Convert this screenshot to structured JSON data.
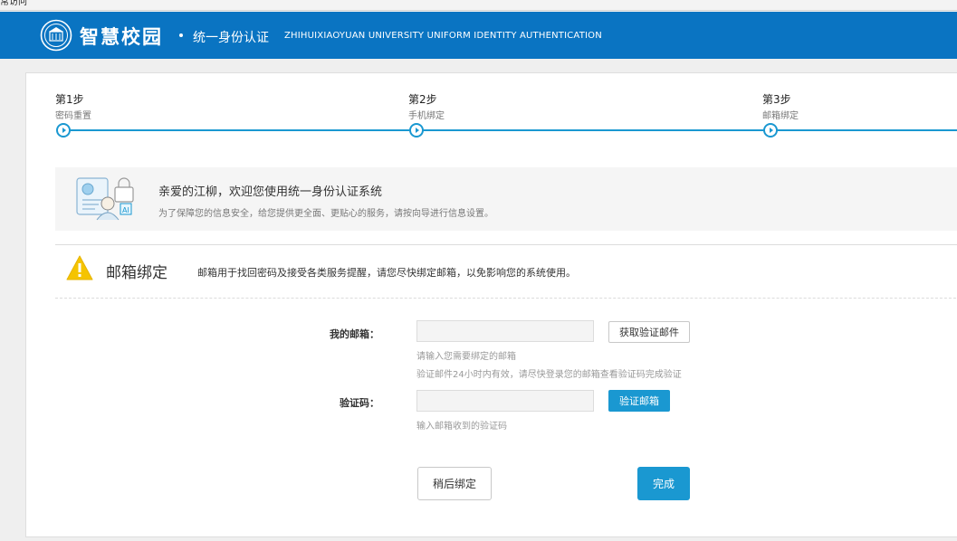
{
  "browser": {
    "top_strip_text": "常访问"
  },
  "header": {
    "logo_text": "智慧校园",
    "subtitle": "统一身份认证",
    "english": "ZHIHUIXIAOYUAN UNIVERSITY UNIFORM IDENTITY AUTHENTICATION"
  },
  "steps": [
    {
      "title": "第1步",
      "desc": "密码重置"
    },
    {
      "title": "第2步",
      "desc": "手机绑定"
    },
    {
      "title": "第3步",
      "desc": "邮箱绑定"
    }
  ],
  "welcome": {
    "title": "亲爱的江柳，欢迎您使用统一身份认证系统",
    "desc": "为了保障您的信息安全，给您提供更全面、更贴心的服务，请按向导进行信息设置。"
  },
  "section": {
    "title": "邮箱绑定",
    "desc": "邮箱用于找回密码及接受各类服务提醒，请您尽快绑定邮箱，以免影响您的系统使用。"
  },
  "form": {
    "email_label": "我的邮箱：",
    "email_value": "",
    "email_hint1": "请输入您需要绑定的邮箱",
    "email_hint2": "验证邮件24小时内有效，请尽快登录您的邮箱查看验证码完成验证",
    "get_code_label": "获取验证邮件",
    "code_label": "验证码：",
    "code_value": "",
    "code_hint": "输入邮箱收到的验证码",
    "verify_label": "验证邮箱"
  },
  "actions": {
    "later_label": "稍后绑定",
    "done_label": "完成"
  },
  "colors": {
    "header_bg": "#0a74c2",
    "accent": "#1a98d1",
    "warning": "#f5c400"
  }
}
